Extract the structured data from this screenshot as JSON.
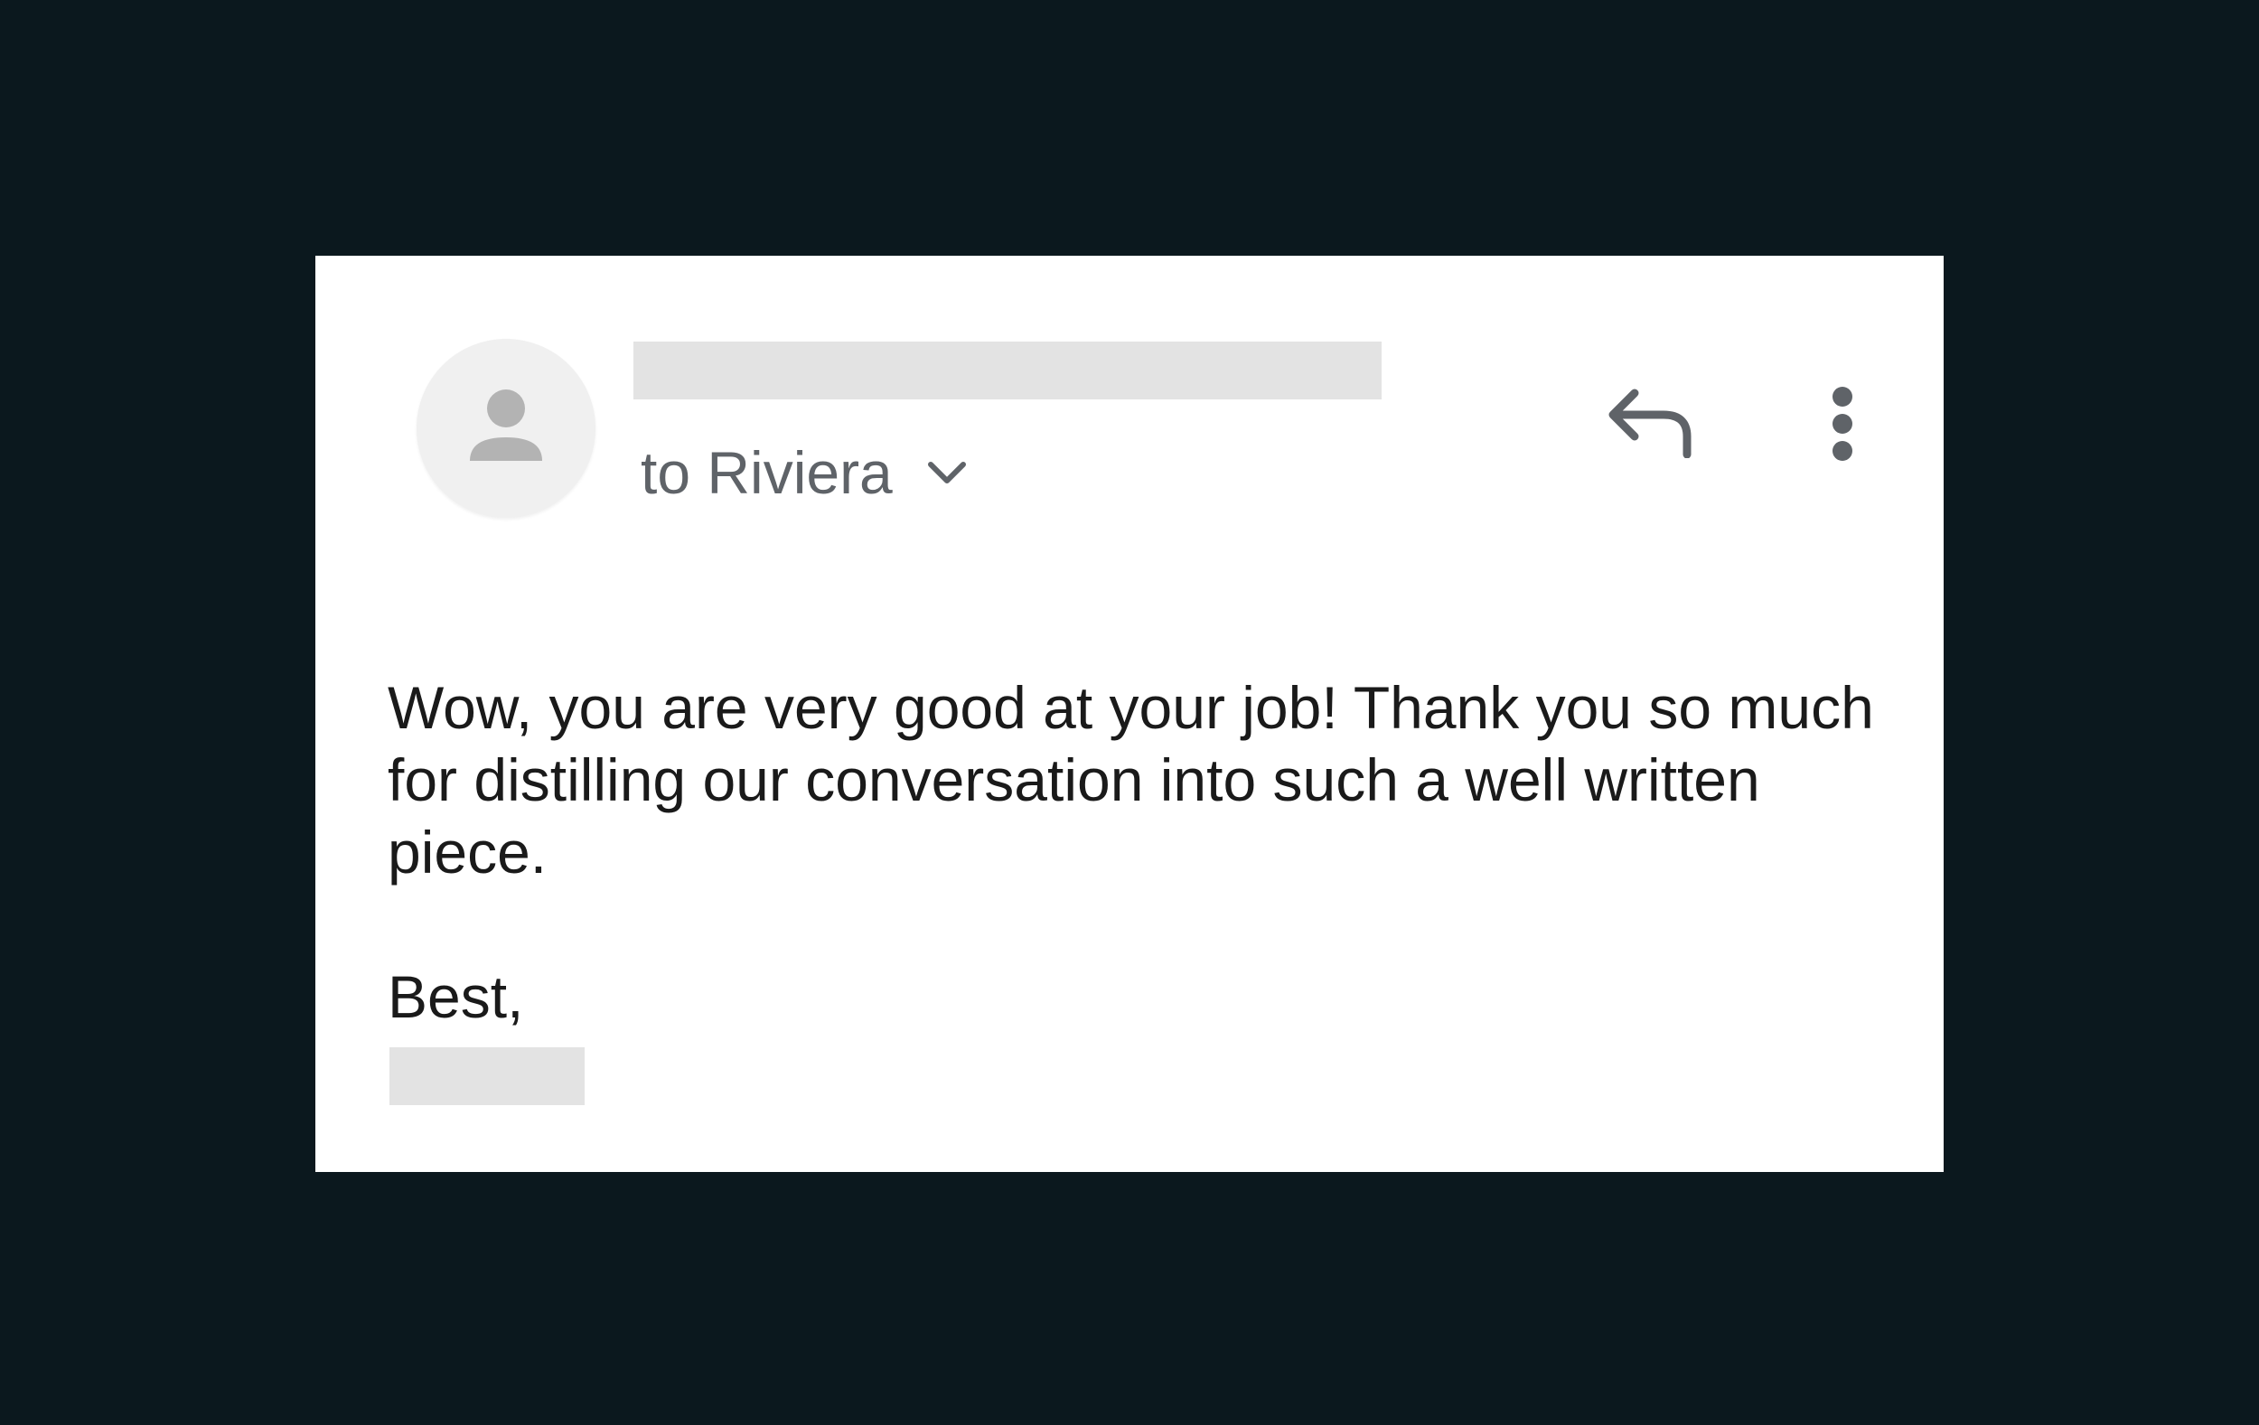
{
  "email": {
    "sender_name": "",
    "recipient_line": "to Riviera",
    "body": "Wow, you are very good at your job! Thank you so much for distilling our conversation into such a well written piece.",
    "closing": "Best,",
    "signature_name": ""
  },
  "icons": {
    "avatar": "person-icon",
    "expand": "chevron-down-icon",
    "reply": "reply-icon",
    "more": "more-vert-icon"
  },
  "colors": {
    "background": "#0b181e",
    "card": "#ffffff",
    "redaction": "#e3e3e3",
    "secondary_text": "#5f6368",
    "body_text": "#1a1a1a"
  }
}
